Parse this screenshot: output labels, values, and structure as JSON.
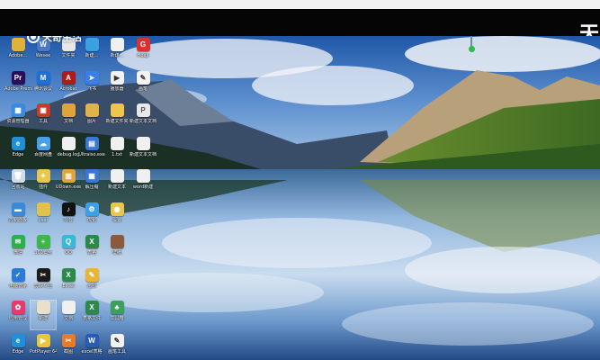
{
  "corner_text": "天",
  "watermark": {
    "text": "天奇生活"
  },
  "colors": {
    "blackbar": "#050505",
    "sky": "#5d8fcb",
    "forest": "#2f5a1e",
    "lake": "#6d99c9"
  },
  "icons": [
    {
      "label": "Adobe…",
      "icon": "folder-icon",
      "color": "#e0b23a",
      "glyph": ""
    },
    {
      "label": "Wesee",
      "icon": "app-icon",
      "color": "#4a78c8",
      "glyph": "W"
    },
    {
      "label": "文件夹",
      "icon": "document-icon",
      "color": "#e8e8e8",
      "glyph": ""
    },
    {
      "label": "新建…",
      "icon": "app-icon",
      "color": "#3aa0e0",
      "glyph": ""
    },
    {
      "label": "新建…",
      "icon": "document-icon",
      "color": "#f0f0f0",
      "glyph": ""
    },
    {
      "label": "HuaJi",
      "icon": "app-icon",
      "color": "#d8322a",
      "glyph": "G"
    },
    {
      "label": "Adobe Premiere",
      "icon": "premiere-icon",
      "color": "#2a0e5a",
      "glyph": "Pr"
    },
    {
      "label": "腾讯会议",
      "icon": "app-icon",
      "color": "#1e6fd9",
      "glyph": "M"
    },
    {
      "label": "Acrobat",
      "icon": "acrobat-icon",
      "color": "#b01a1a",
      "glyph": "A"
    },
    {
      "label": "飞书",
      "icon": "app-icon",
      "color": "#3a7fe8",
      "glyph": "➤"
    },
    {
      "label": "播放器",
      "icon": "app-icon",
      "color": "#f2f2f2",
      "glyph": "▶"
    },
    {
      "label": "画笔",
      "icon": "app-icon",
      "color": "#f2f2f2",
      "glyph": "✎"
    },
    {
      "label": "资源管理器",
      "icon": "app-icon",
      "color": "#3a8be0",
      "glyph": "▦"
    },
    {
      "label": "工具",
      "icon": "app-icon",
      "color": "#c83a2a",
      "glyph": "▣"
    },
    {
      "label": "文档",
      "icon": "folder-icon",
      "color": "#e0a43a",
      "glyph": ""
    },
    {
      "label": "图片",
      "icon": "folder-icon",
      "color": "#e0b24a",
      "glyph": ""
    },
    {
      "label": "新建文件夹",
      "icon": "folder-icon",
      "color": "#f0c64a",
      "glyph": ""
    },
    {
      "label": "新建文本文档.pdf",
      "icon": "pdf-icon",
      "color": "#e8e8e8",
      "glyph": "P"
    },
    {
      "label": "Edge",
      "icon": "edge-icon",
      "color": "#1f8fd8",
      "glyph": "e"
    },
    {
      "label": "百度网盘",
      "icon": "cloud-icon",
      "color": "#4aa0e8",
      "glyph": "☁"
    },
    {
      "label": "debug.log",
      "icon": "document-icon",
      "color": "#f0f0f0",
      "glyph": ""
    },
    {
      "label": "Ultraiso.exe",
      "icon": "app-icon",
      "color": "#3b78d6",
      "glyph": "▤"
    },
    {
      "label": "1.txt",
      "icon": "document-icon",
      "color": "#f0f0f0",
      "glyph": ""
    },
    {
      "label": "新建文本文档",
      "icon": "document-icon",
      "color": "#f0f0f0",
      "glyph": ""
    },
    {
      "label": "回收站",
      "icon": "recycle-bin-icon",
      "color": "#d0dce8",
      "glyph": "🗑"
    },
    {
      "label": "插件",
      "icon": "app-icon",
      "color": "#e8c84a",
      "glyph": "✦"
    },
    {
      "label": "UDown.exe",
      "icon": "app-icon",
      "color": "#e0a43a",
      "glyph": "▥"
    },
    {
      "label": "解压缩",
      "icon": "app-icon",
      "color": "#3a78d8",
      "glyph": "▦"
    },
    {
      "label": "新建文本",
      "icon": "document-icon",
      "color": "#f0f0f0",
      "glyph": ""
    },
    {
      "label": "word新建",
      "icon": "document-icon",
      "color": "#f0f0f0",
      "glyph": ""
    },
    {
      "label": "控制面板",
      "icon": "control-panel-icon",
      "color": "#3a8ad8",
      "glyph": "▬"
    },
    {
      "label": "user",
      "icon": "folder-icon",
      "color": "#e0c24a",
      "glyph": ""
    },
    {
      "label": "抖音",
      "icon": "tiktok-icon",
      "color": "#111111",
      "glyph": "♪"
    },
    {
      "label": "优化",
      "icon": "app-icon",
      "color": "#3aa0e8",
      "glyph": "⚙"
    },
    {
      "label": "设置",
      "icon": "app-icon",
      "color": "#e8c84a",
      "glyph": "◉"
    },
    {
      "label": "",
      "icon": "",
      "color": "",
      "glyph": ""
    },
    {
      "label": "微信",
      "icon": "wechat-icon",
      "color": "#2ab24a",
      "glyph": "✉"
    },
    {
      "label": "360安全",
      "icon": "app-icon",
      "color": "#3ab84a",
      "glyph": "+"
    },
    {
      "label": "QQ",
      "icon": "app-icon",
      "color": "#3ab8d8",
      "glyph": "Q"
    },
    {
      "label": "表格",
      "icon": "excel-icon",
      "color": "#2a8a4a",
      "glyph": "X"
    },
    {
      "label": "壁纸",
      "icon": "image-icon",
      "color": "#8a5a3a",
      "glyph": ""
    },
    {
      "label": "",
      "icon": "",
      "color": "",
      "glyph": ""
    },
    {
      "label": "电脑管家",
      "icon": "shield-icon",
      "color": "#2a7ad8",
      "glyph": "✓"
    },
    {
      "label": "剪映专业",
      "icon": "capcut-icon",
      "color": "#1a1a1a",
      "glyph": "✂"
    },
    {
      "label": "Excel",
      "icon": "excel-icon",
      "color": "#2a8a4a",
      "glyph": "X"
    },
    {
      "label": "画图",
      "icon": "app-icon",
      "color": "#e8b43a",
      "glyph": "✎"
    },
    {
      "label": "",
      "icon": "",
      "color": "",
      "glyph": ""
    },
    {
      "label": "",
      "icon": "",
      "color": "",
      "glyph": ""
    },
    {
      "label": "应用管理",
      "icon": "app-icon",
      "color": "#e83a6a",
      "glyph": "✿"
    },
    {
      "label": "新建",
      "icon": "document-icon",
      "color": "#e8e0c8",
      "glyph": ""
    },
    {
      "label": "文档",
      "icon": "document-icon",
      "color": "#f0f0f0",
      "glyph": ""
    },
    {
      "label": "表格文件",
      "icon": "excel-icon",
      "color": "#2a8a4a",
      "glyph": "X"
    },
    {
      "label": "工具箱",
      "icon": "app-icon",
      "color": "#3aa05a",
      "glyph": "♣"
    },
    {
      "label": "",
      "icon": "",
      "color": "",
      "glyph": ""
    },
    {
      "label": "Edge",
      "icon": "edge-icon",
      "color": "#1f8fd8",
      "glyph": "e"
    },
    {
      "label": "PotPlayer 64",
      "icon": "app-icon",
      "color": "#e8c83a",
      "glyph": "▶"
    },
    {
      "label": "截图",
      "icon": "app-icon",
      "color": "#e87a2a",
      "glyph": "✂"
    },
    {
      "label": "excel表格",
      "icon": "word-icon",
      "color": "#2a5ab8",
      "glyph": "W"
    },
    {
      "label": "画笔工具",
      "icon": "app-icon",
      "color": "#f2f2f2",
      "glyph": "✎"
    },
    {
      "label": "",
      "icon": "",
      "color": "",
      "glyph": ""
    }
  ]
}
